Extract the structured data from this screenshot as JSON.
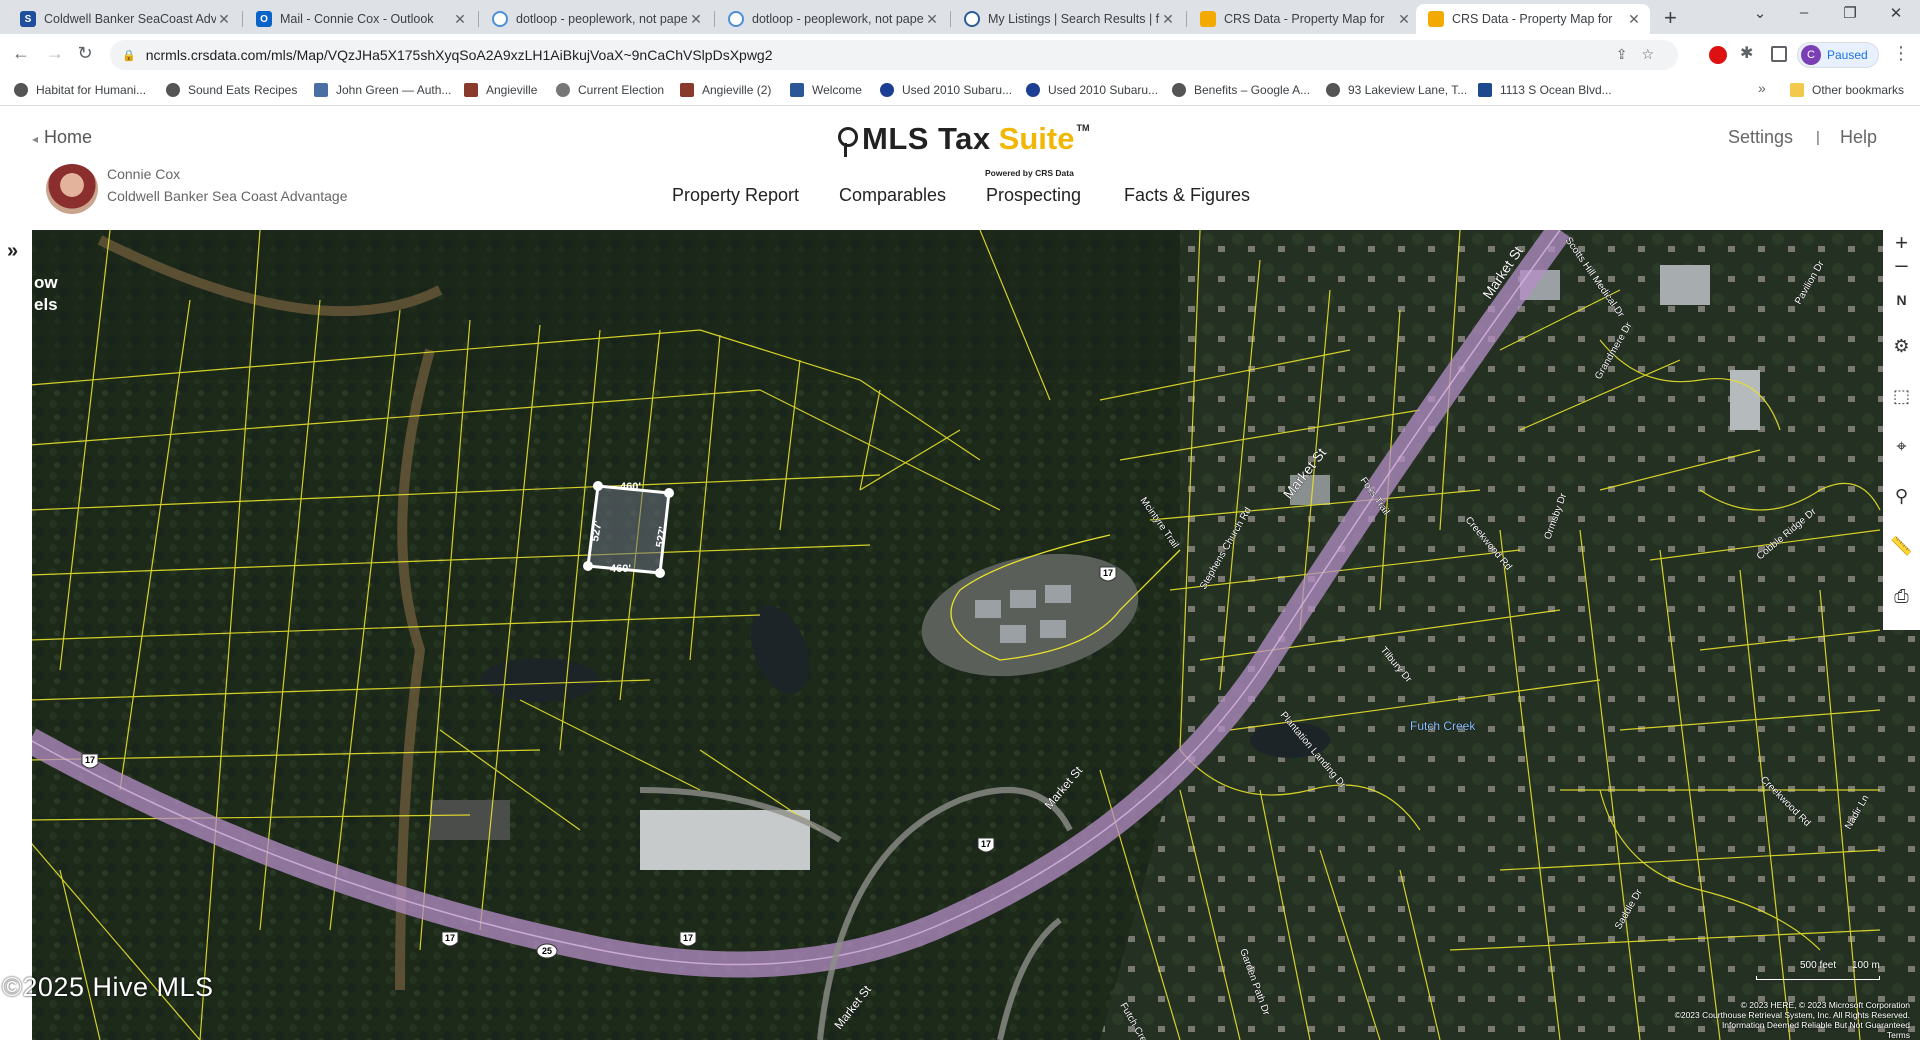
{
  "browser": {
    "tabs": [
      {
        "title": "Coldwell Banker SeaCoast Advan",
        "favicon": "coldwell-banker-icon",
        "color": "#1f4e9c"
      },
      {
        "title": "Mail - Connie Cox - Outlook",
        "favicon": "outlook-icon",
        "color": "#0a64c8"
      },
      {
        "title": "dotloop - peoplework, not pape",
        "favicon": "dotloop-icon",
        "color": "#4a90d9"
      },
      {
        "title": "dotloop - peoplework, not pape",
        "favicon": "dotloop-icon",
        "color": "#4a90d9"
      },
      {
        "title": "My Listings | Search Results | fle",
        "favicon": "mls-pin-icon",
        "color": "#2d5b9a"
      },
      {
        "title": "CRS Data - Property Map for",
        "favicon": "crs-data-icon",
        "color": "#f2a900"
      },
      {
        "title": "CRS Data - Property Map for",
        "favicon": "crs-data-icon",
        "color": "#f2a900"
      }
    ],
    "url": "ncrmls.crsdata.com/mls/Map/VQzJHa5X175shXyqSoA2A9xzLH1AiBkujVoaX~9nCaChVSlpDsXpwg2",
    "profile_status": "Paused",
    "bookmarks": [
      "Habitat for Humani...",
      "Sound Eats",
      "Recipes",
      "John Green — Auth...",
      "Angieville",
      "Current Election",
      "Angieville (2)",
      "Welcome",
      "Used 2010 Subaru...",
      "Used 2010 Subaru...",
      "Benefits – Google A...",
      "93 Lakeview Lane, T...",
      "1113 S Ocean Blvd..."
    ],
    "other_bookmarks": "Other bookmarks"
  },
  "app": {
    "home_label": "Home",
    "user_name": "Connie Cox",
    "user_company": "Coldwell Banker Sea Coast Advantage",
    "logo_part1": "MLS Tax",
    "logo_part2": "Suite",
    "logo_tm": "TM",
    "logo_powered": "Powered by CRS Data",
    "settings_label": "Settings",
    "separator": "|",
    "help_label": "Help",
    "nav": [
      "Property Report",
      "Comparables",
      "Prospecting",
      "Facts & Figures"
    ]
  },
  "map": {
    "side_text_lines": [
      "ow",
      "els"
    ],
    "selected_parcel": {
      "top": "460'",
      "bottom": "460'",
      "left": "527'",
      "right": "527'"
    },
    "street_labels": [
      "Market St",
      "Market St",
      "Market St",
      "Market St",
      "Stephens Church Rd",
      "Mcintyre Trail",
      "Foxs Trail",
      "Creekwood Rd",
      "Ormsby Dr",
      "Tilbury Dr",
      "Plantation Landing Dr",
      "Futch Creek",
      "Futch Creek Rd",
      "Scotts Hill Medical Dr",
      "Pavilion Dr",
      "Grandmere Dr",
      "Cobble Ridge Dr",
      "Garden Path Dr",
      "Saddle Dr",
      "Nadir Ln",
      "Creekwood Rd"
    ],
    "route_shields": [
      "17",
      "17",
      "17",
      "17",
      "17",
      "25"
    ],
    "watermark": "©2025 Hive MLS",
    "scale_ft": "500 feet",
    "scale_m": "100 m",
    "attribution_lines": [
      "© 2023 HERE, © 2023 Microsoft Corporation",
      "©2023 Courthouse Retrieval System, Inc. All Rights Reserved.",
      "Information Deemed Reliable But Not Guaranteed"
    ],
    "terms": "Terms",
    "controls": [
      "zoom-in-icon",
      "zoom-out-icon",
      "north-compass-icon",
      "gear-icon",
      "select-area-icon",
      "locate-icon",
      "search-icon",
      "measure-ruler-icon",
      "print-icon"
    ]
  }
}
